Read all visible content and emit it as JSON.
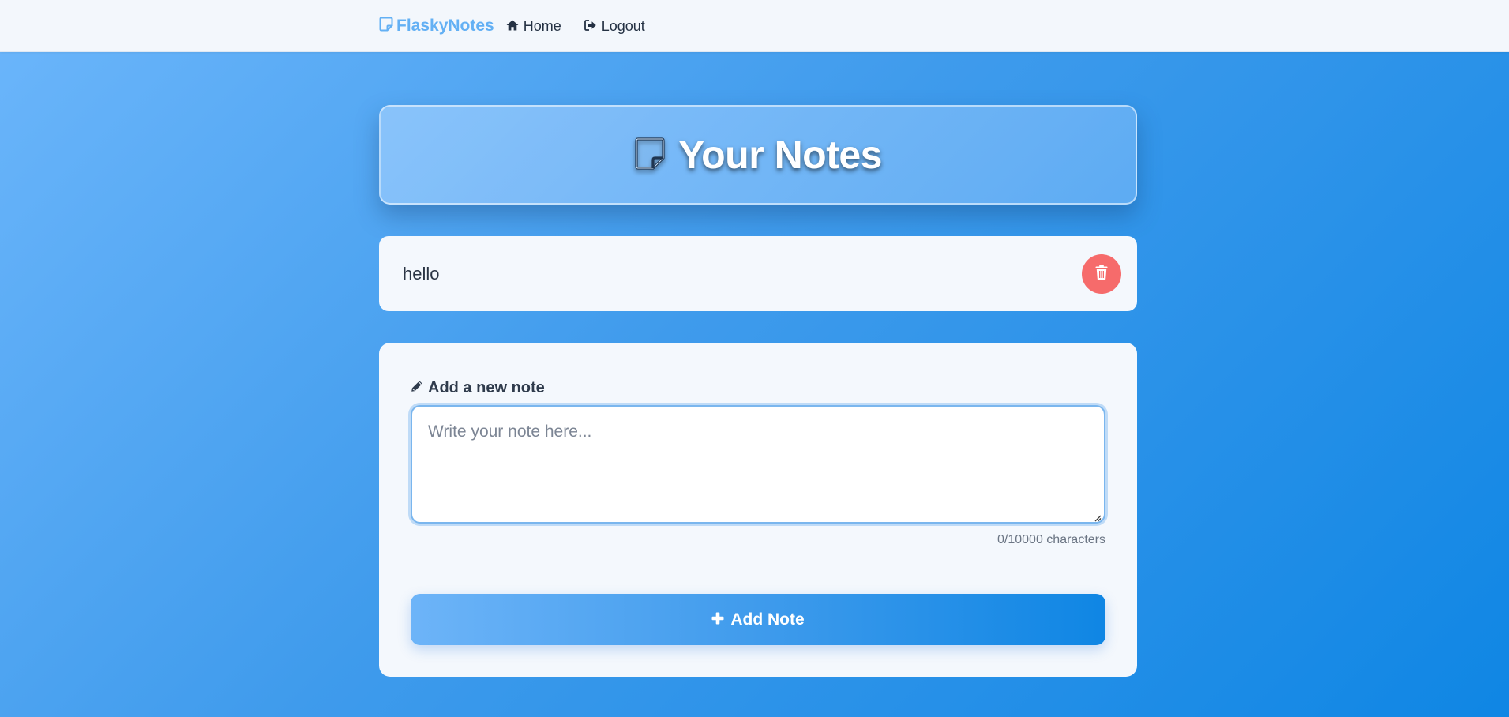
{
  "navbar": {
    "brand": "FlaskyNotes",
    "links": [
      {
        "label": "Home",
        "icon": "home-icon"
      },
      {
        "label": "Logout",
        "icon": "logout-icon"
      }
    ]
  },
  "header": {
    "title": "Your Notes",
    "icon": "sticky-note-icon"
  },
  "notes": [
    {
      "text": "hello",
      "delete_icon": "trash-icon"
    }
  ],
  "form": {
    "label": "Add a new note",
    "label_icon": "pencil-icon",
    "textarea_placeholder": "Write your note here...",
    "textarea_value": "",
    "char_count": "0/10000 characters",
    "submit_label": "Add Note",
    "submit_icon": "plus-icon"
  },
  "colors": {
    "brand": "#63b0f4",
    "delete": "#f66b6b",
    "accent": "#0f86e4"
  }
}
